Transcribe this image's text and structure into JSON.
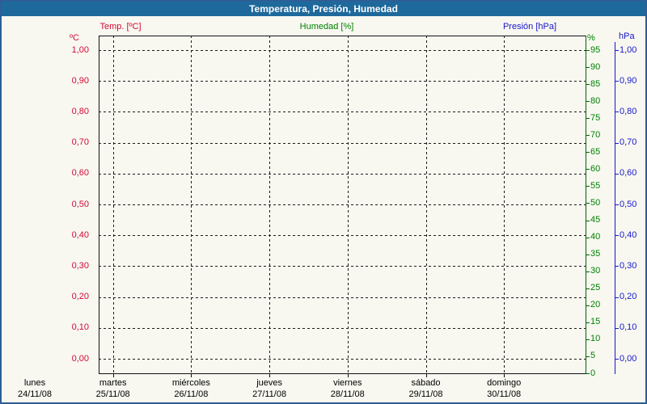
{
  "window": {
    "title": "Temperatura, Presión, Humedad",
    "titlebar_color": "#1e699c",
    "frame_color": "#2d5f95",
    "background_color": "#f8f8f1"
  },
  "legend": {
    "temp": {
      "label": "Temp. [ºC]",
      "color": "#d40a35"
    },
    "humidity": {
      "label": "Humedad [%]",
      "color": "#008000"
    },
    "pressure": {
      "label": "Presión [hPa]",
      "color": "#1717cc"
    }
  },
  "chart_data": {
    "type": "line",
    "title": "Temperatura, Presión, Humedad",
    "grid": true,
    "series": [
      {
        "name": "Temp. [ºC]",
        "axis": "temperature",
        "color": "#d40a35",
        "values": []
      },
      {
        "name": "Humedad [%]",
        "axis": "humidity",
        "color": "#008000",
        "values": []
      },
      {
        "name": "Presión [hPa]",
        "axis": "pressure",
        "color": "#1717cc",
        "values": []
      }
    ],
    "y_axes": {
      "temperature": {
        "unit": "ºC",
        "side": "left",
        "min": 0,
        "max": 1,
        "step": 0.1,
        "tick_labels": [
          "1,00",
          "0,90",
          "0,80",
          "0,70",
          "0,60",
          "0,50",
          "0,40",
          "0,30",
          "0,20",
          "0,10",
          "0,00"
        ],
        "color": "#d40a35"
      },
      "humidity": {
        "unit": "%",
        "side": "right-inner",
        "min": 0,
        "max": 95,
        "step": 5,
        "tick_labels": [
          "95",
          "90",
          "85",
          "80",
          "75",
          "70",
          "65",
          "60",
          "55",
          "50",
          "45",
          "40",
          "35",
          "30",
          "25",
          "20",
          "15",
          "10",
          "5",
          "0"
        ],
        "color": "#008000"
      },
      "pressure": {
        "unit": "hPa",
        "side": "right-outer",
        "min": 0,
        "max": 1,
        "step": 0.1,
        "tick_labels": [
          "1,00",
          "0,90",
          "0,80",
          "0,70",
          "0,60",
          "0,50",
          "0,40",
          "0,30",
          "0,20",
          "0,10",
          "0,00"
        ],
        "color": "#1717cc"
      }
    },
    "x_axis": {
      "days": [
        {
          "name": "lunes",
          "date": "24/11/08"
        },
        {
          "name": "martes",
          "date": "25/11/08"
        },
        {
          "name": "miércoles",
          "date": "26/11/08"
        },
        {
          "name": "jueves",
          "date": "27/11/08"
        },
        {
          "name": "viernes",
          "date": "28/11/08"
        },
        {
          "name": "sábado",
          "date": "29/11/08"
        },
        {
          "name": "domingo",
          "date": "30/11/08"
        }
      ]
    }
  }
}
